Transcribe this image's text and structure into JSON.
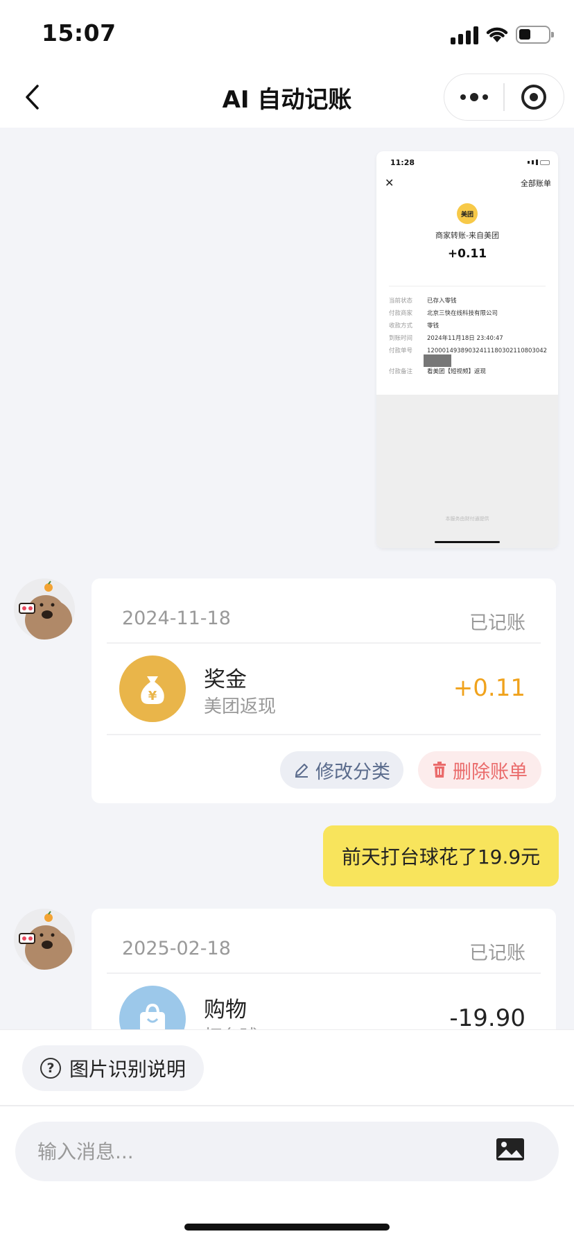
{
  "status_bar": {
    "time": "15:07"
  },
  "nav": {
    "title": "AI 自动记账"
  },
  "screenshot": {
    "time": "11:28",
    "all_bills": "全部账单",
    "logo_text": "美团",
    "merchant": "商家转账-来自美团",
    "amount": "+0.11",
    "rows": [
      {
        "k": "当前状态",
        "v": "已存入零钱"
      },
      {
        "k": "付款商家",
        "v": "北京三快在线科技有限公司"
      },
      {
        "k": "收款方式",
        "v": "零钱"
      },
      {
        "k": "到账时间",
        "v": "2024年11月18日 23:40:47"
      },
      {
        "k": "付款单号",
        "v": "12000149389032411180302110803042 81"
      },
      {
        "k": "付款备注",
        "v": "看美团【短视频】返现"
      }
    ],
    "footer": "本服务由财付通提供"
  },
  "bills": [
    {
      "date": "2024-11-18",
      "status": "已记账",
      "category": "奖金",
      "note": "美团返现",
      "amount": "+0.11",
      "amount_color": "#f0a21c",
      "icon": "money-bag-icon",
      "icon_bg": "#e9b54a"
    },
    {
      "date": "2025-02-18",
      "status": "已记账",
      "category": "购物",
      "note": "打台球",
      "amount": "-19.90",
      "amount_color": "#222222",
      "icon": "shopping-bag-icon",
      "icon_bg": "#9cc8ea"
    }
  ],
  "actions": {
    "edit": "修改分类",
    "delete": "删除账单"
  },
  "user_message": "前天打台球花了19.9元",
  "help_button": "图片识别说明",
  "input": {
    "placeholder": "输入消息..."
  }
}
